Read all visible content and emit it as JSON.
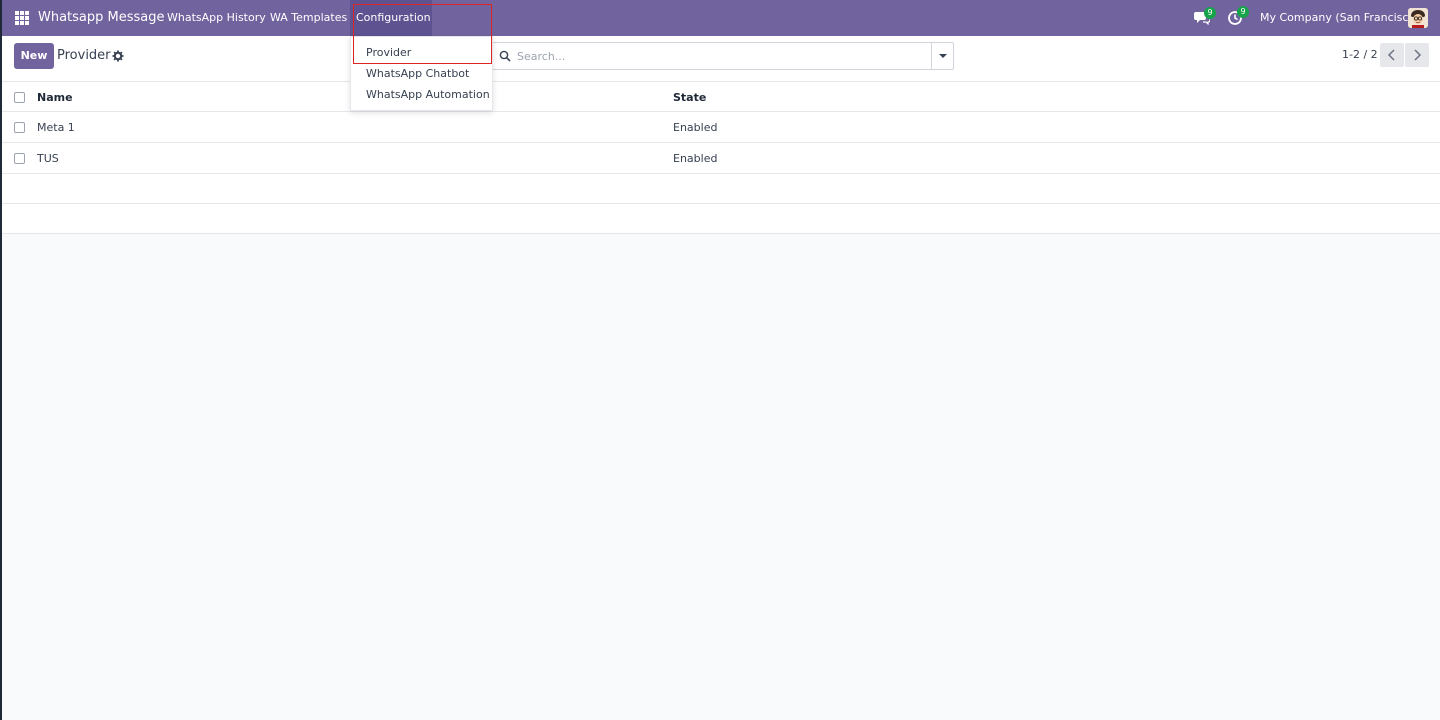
{
  "navbar": {
    "app_title": "Whatsapp Message",
    "menu": {
      "history": "WhatsApp History",
      "templates": "WA Templates",
      "configuration": "Configuration"
    },
    "messages_count": "9",
    "activities_count": "9",
    "company": "My Company (San Francisco)",
    "color": "#71639e"
  },
  "dropdown": {
    "items": [
      "Provider",
      "WhatsApp Chatbot",
      "WhatsApp Automation"
    ]
  },
  "control_panel": {
    "new_label": "New",
    "title": "Provider",
    "search_placeholder": "Search...",
    "pager": "1-2 / 2"
  },
  "list": {
    "columns": [
      "Name",
      "State"
    ],
    "rows": [
      {
        "name": "Meta 1",
        "state": "Enabled"
      },
      {
        "name": "TUS",
        "state": "Enabled"
      }
    ]
  }
}
